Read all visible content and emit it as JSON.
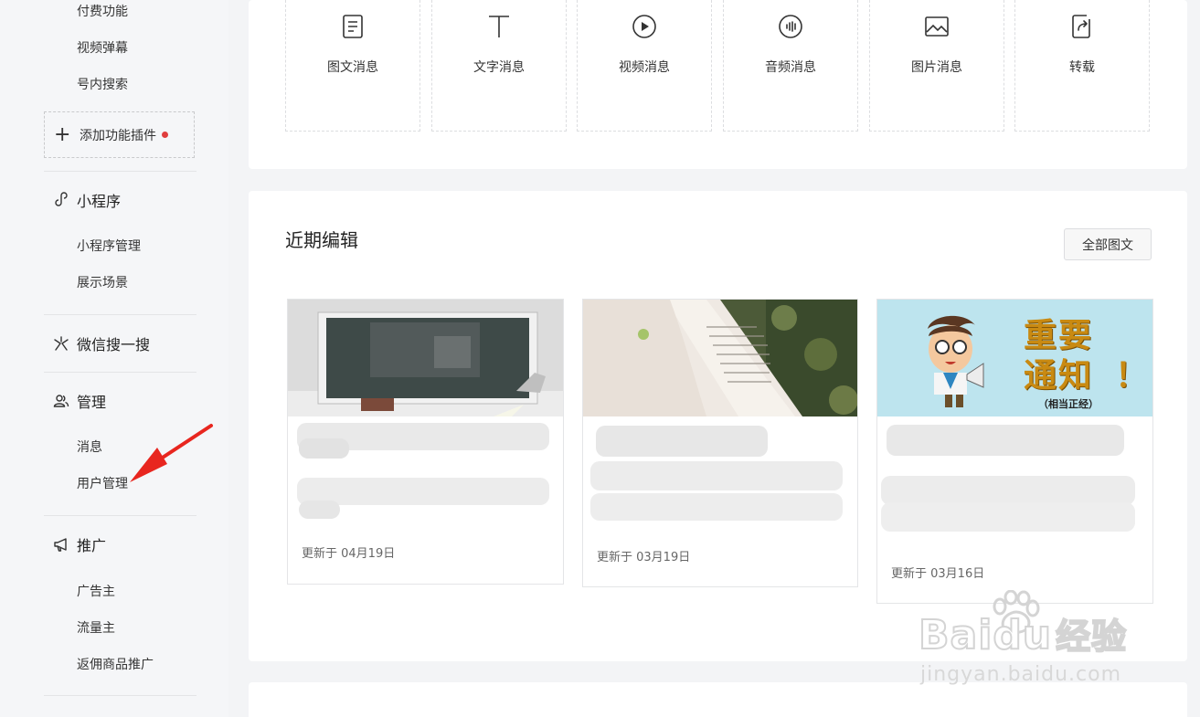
{
  "sidebar": {
    "top_items": [
      "付费功能",
      "视频弹幕",
      "号内搜索"
    ],
    "add_plugin": "添加功能插件",
    "miniprogram": {
      "title": "小程序",
      "items": [
        "小程序管理",
        "展示场景"
      ]
    },
    "search": {
      "title": "微信搜一搜"
    },
    "manage": {
      "title": "管理",
      "items": [
        "消息",
        "用户管理"
      ]
    },
    "promote": {
      "title": "推广",
      "items": [
        "广告主",
        "流量主",
        "返佣商品推广"
      ]
    }
  },
  "message_types": [
    {
      "label": "图文消息",
      "icon": "document-icon"
    },
    {
      "label": "文字消息",
      "icon": "text-icon"
    },
    {
      "label": "视频消息",
      "icon": "video-icon"
    },
    {
      "label": "音频消息",
      "icon": "audio-icon"
    },
    {
      "label": "图片消息",
      "icon": "image-icon"
    },
    {
      "label": "转载",
      "icon": "share-icon"
    }
  ],
  "recent": {
    "title": "近期编辑",
    "all_button": "全部图文",
    "articles": [
      {
        "date": "更新于 04月19日"
      },
      {
        "date": "更新于 03月19日"
      },
      {
        "date": "更新于 03月16日",
        "thumb_text": [
          "重要",
          "通知",
          "！",
          "（相当正经）"
        ]
      }
    ]
  },
  "watermark": {
    "brand": "Bai",
    "brand_tail": "du",
    "suffix": "经验",
    "url": "jingyan.baidu.com"
  },
  "colors": {
    "accent_red": "#e03e3e",
    "arrow_red": "#e8261f",
    "card_bg": "#ffffff",
    "page_bg": "#f3f4f6"
  }
}
